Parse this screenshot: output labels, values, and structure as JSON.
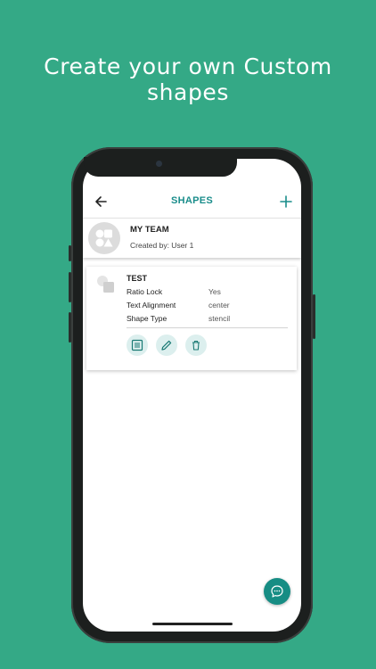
{
  "promo": {
    "headline": "Create your own Custom shapes"
  },
  "appbar": {
    "back_icon": "arrow-left-icon",
    "title": "SHAPES",
    "add_icon": "plus-icon"
  },
  "team": {
    "name": "MY TEAM",
    "created_by": "Created by: User 1"
  },
  "shape": {
    "name": "TEST",
    "properties": [
      {
        "label": "Ratio Lock",
        "value": "Yes"
      },
      {
        "label": "Text Alignment",
        "value": "center"
      },
      {
        "label": "Shape Type",
        "value": "stencil"
      }
    ],
    "actions": [
      "details-icon",
      "edit-icon",
      "delete-icon"
    ]
  },
  "fab_icon": "chat-icon",
  "colors": {
    "background": "#34a986",
    "accent": "#1a8d8b",
    "fab": "#178d84"
  }
}
